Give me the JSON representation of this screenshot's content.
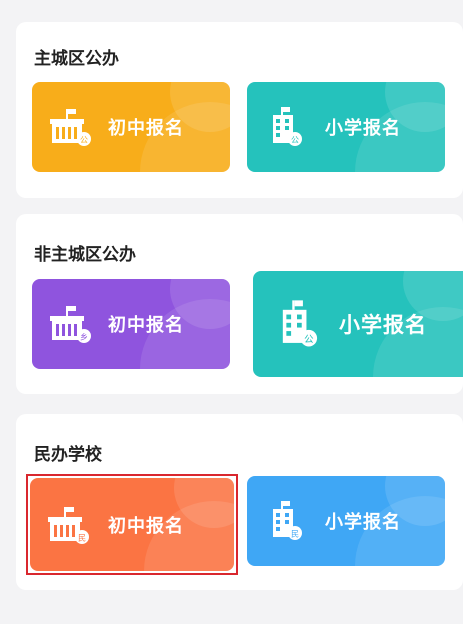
{
  "sections": [
    {
      "title": "主城区公办",
      "cards": [
        {
          "label": "初中报名",
          "color": "#f8ad1a",
          "icon": "school-building-icon",
          "badge": "公"
        },
        {
          "label": "小学报名",
          "color": "#25c2bc",
          "icon": "office-building-icon",
          "badge": "公"
        }
      ]
    },
    {
      "title": "非主城区公办",
      "cards": [
        {
          "label": "初中报名",
          "color": "#8f54de",
          "icon": "school-building-icon",
          "badge": "乡"
        },
        {
          "label": "小学报名",
          "color": "#25c2bc",
          "icon": "office-building-icon",
          "badge": "公"
        }
      ]
    },
    {
      "title": "民办学校",
      "cards": [
        {
          "label": "初中报名",
          "color": "#fb7443",
          "icon": "school-building-icon",
          "badge": "民"
        },
        {
          "label": "小学报名",
          "color": "#3fa7f5",
          "icon": "office-building-icon",
          "badge": "民"
        }
      ]
    }
  ]
}
